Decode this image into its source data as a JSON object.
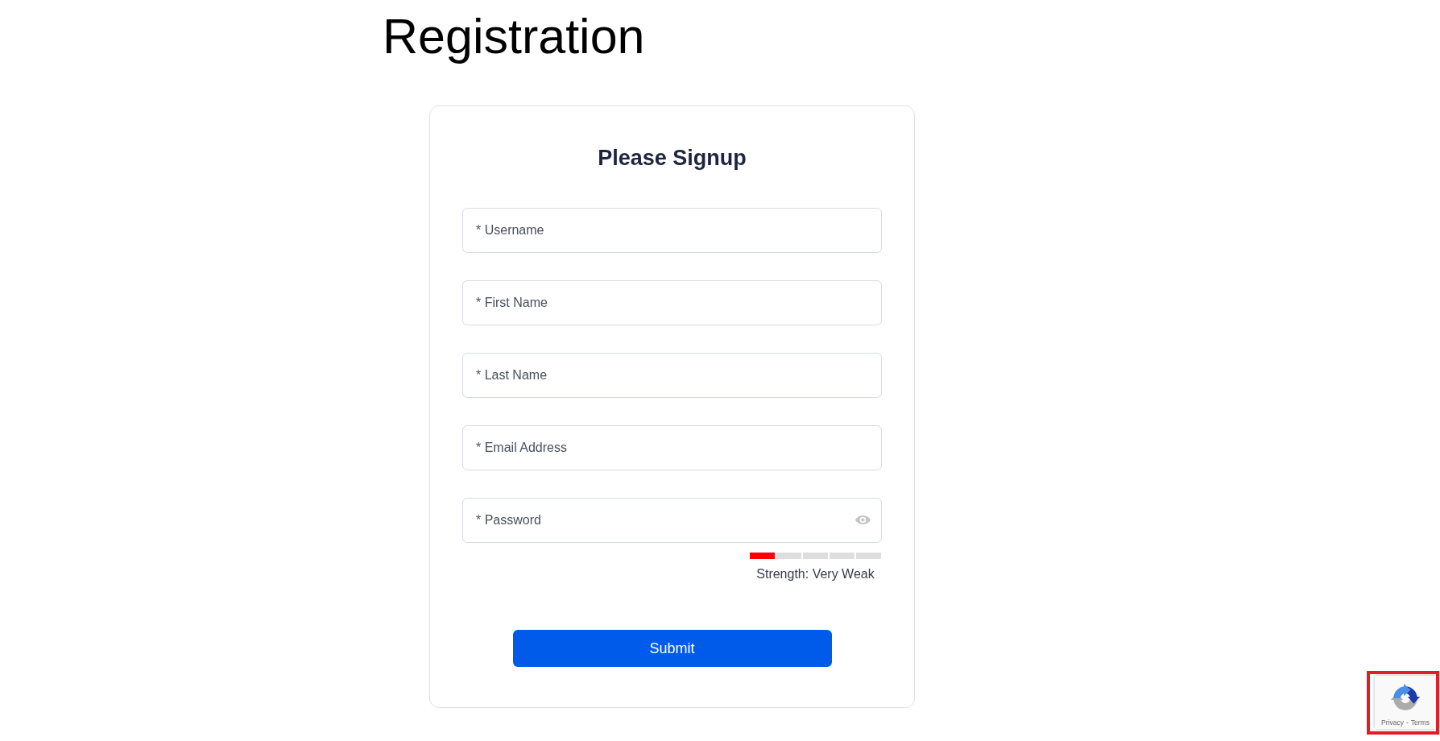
{
  "page": {
    "title": "Registration"
  },
  "signup": {
    "heading": "Please Signup",
    "fields": [
      {
        "kind": "text",
        "placeholder": "* Username"
      },
      {
        "kind": "text",
        "placeholder": "* First Name"
      },
      {
        "kind": "text",
        "placeholder": "* Last Name"
      },
      {
        "kind": "text",
        "placeholder": "* Email Address"
      },
      {
        "kind": "password",
        "placeholder": "* Password"
      }
    ],
    "strength": {
      "level": 0.2,
      "label": "Strength: Very Weak"
    },
    "submit": "Submit"
  },
  "recaptcha": {
    "links": [
      "Privacy",
      "Terms"
    ],
    "separator": "-"
  }
}
